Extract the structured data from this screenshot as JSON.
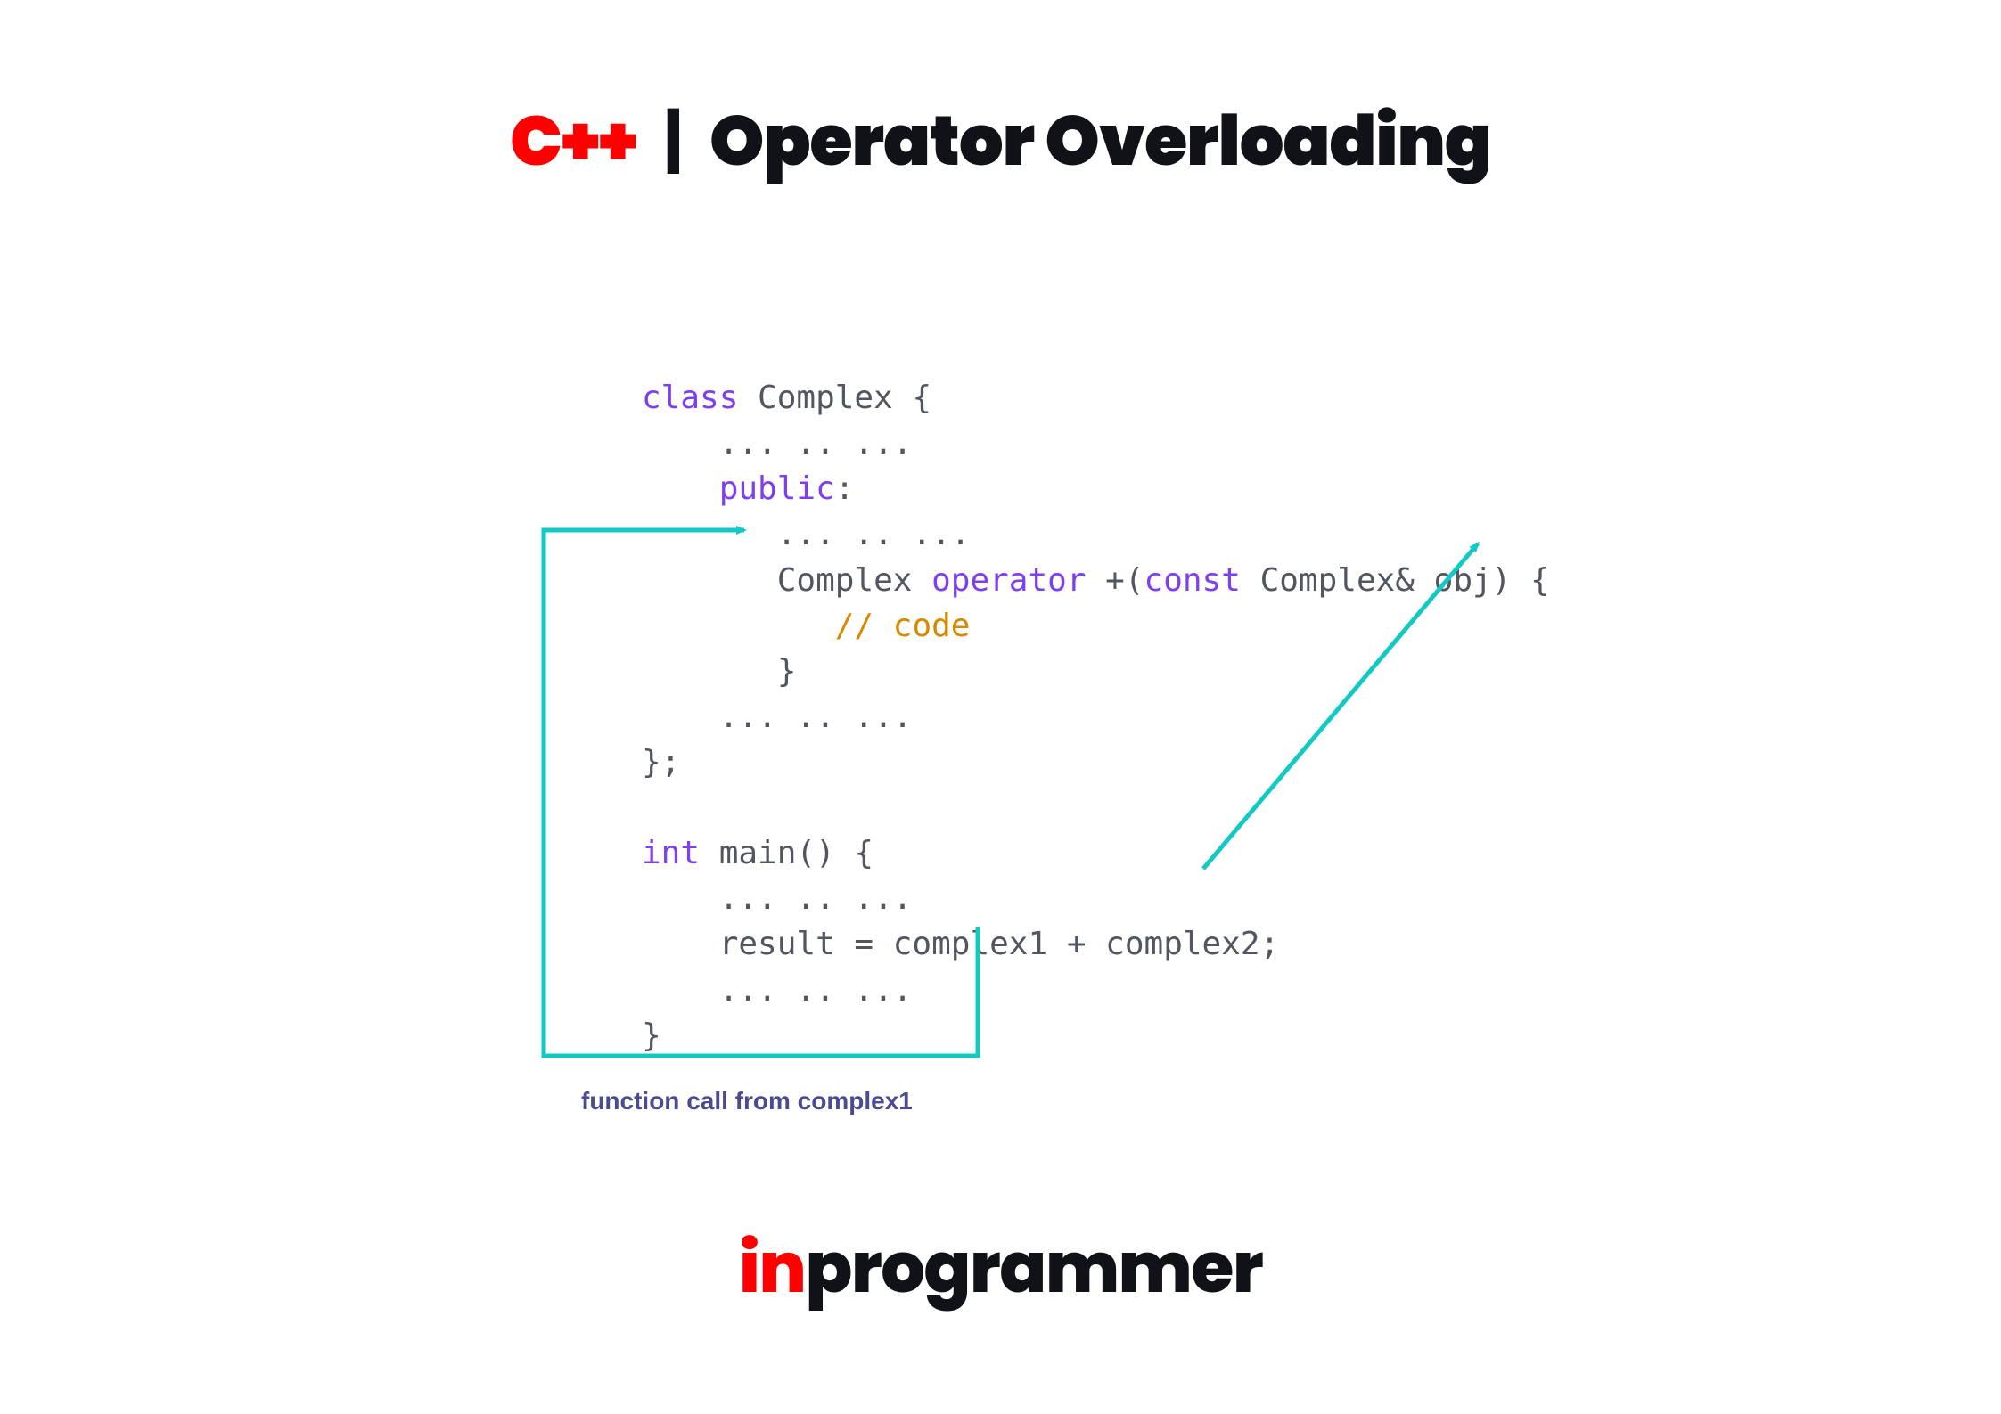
{
  "title": {
    "left": "C++",
    "sep": "|",
    "right": "Operator Overloading"
  },
  "code": {
    "l1a": "class",
    "l1b": " Complex {",
    "l2": "    ... .. ...",
    "l3a": "    ",
    "l3b": "public",
    "l3c": ":",
    "l4": "       ... .. ...",
    "l5a": "       Complex ",
    "l5b": "operator",
    "l5c": " +(",
    "l5d": "const",
    "l5e": " Complex& obj) {",
    "l6a": "          ",
    "l6b": "// code",
    "l7": "       }",
    "l8": "    ... .. ...",
    "l9": "};",
    "l10": " ",
    "l11a": "int",
    "l11b": " main() {",
    "l12": "    ... .. ...",
    "l13": "    result = complex1 + complex2;",
    "l14": "    ... .. ...",
    "l15": "}"
  },
  "caption": "function call from complex1",
  "logo": {
    "a": "in",
    "b": "programmer"
  },
  "colors": {
    "teal": "#13c9c3"
  }
}
